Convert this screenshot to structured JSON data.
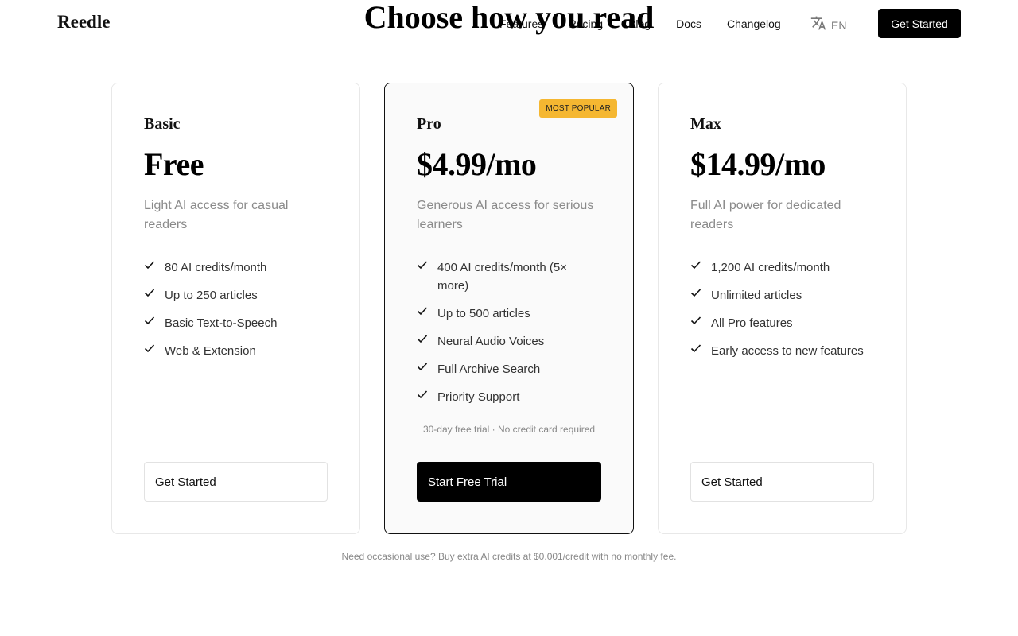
{
  "brand": {
    "name": "Reedle"
  },
  "nav": {
    "links": [
      {
        "label": "Features"
      },
      {
        "label": "Pricing"
      },
      {
        "label": "Blog"
      },
      {
        "label": "Docs"
      },
      {
        "label": "Changelog"
      }
    ],
    "language": {
      "label": "EN",
      "icon": "translate-icon"
    },
    "cta_label": "Get Started"
  },
  "headline": "Choose how you read",
  "plans": [
    {
      "name": "Basic",
      "price": "Free",
      "description": "Light AI access for casual readers",
      "features": [
        "80 AI credits/month",
        "Up to 250 articles",
        "Basic Text-to-Speech",
        "Web & Extension"
      ],
      "button_label": "Get Started"
    },
    {
      "name": "Pro",
      "badge": "MOST POPULAR",
      "price": "$4.99/mo",
      "description": "Generous AI access for serious learners",
      "features": [
        "400 AI credits/month (5× more)",
        "Up to 500 articles",
        "Neural Audio Voices",
        "Full Archive Search",
        "Priority Support"
      ],
      "trial_note": "30-day free trial · No credit card required",
      "button_label": "Start Free Trial"
    },
    {
      "name": "Max",
      "price": "$14.99/mo",
      "description": "Full AI power for dedicated readers",
      "features": [
        "1,200 AI credits/month",
        "Unlimited articles",
        "All Pro features",
        "Early access to new features"
      ],
      "button_label": "Get Started"
    }
  ],
  "footnote": "Need occasional use? Buy extra AI credits at $0.001/credit with no monthly fee.",
  "colors": {
    "badge": "#f5b731",
    "primary_button": "#000000",
    "muted_text": "#8a8a8a"
  }
}
